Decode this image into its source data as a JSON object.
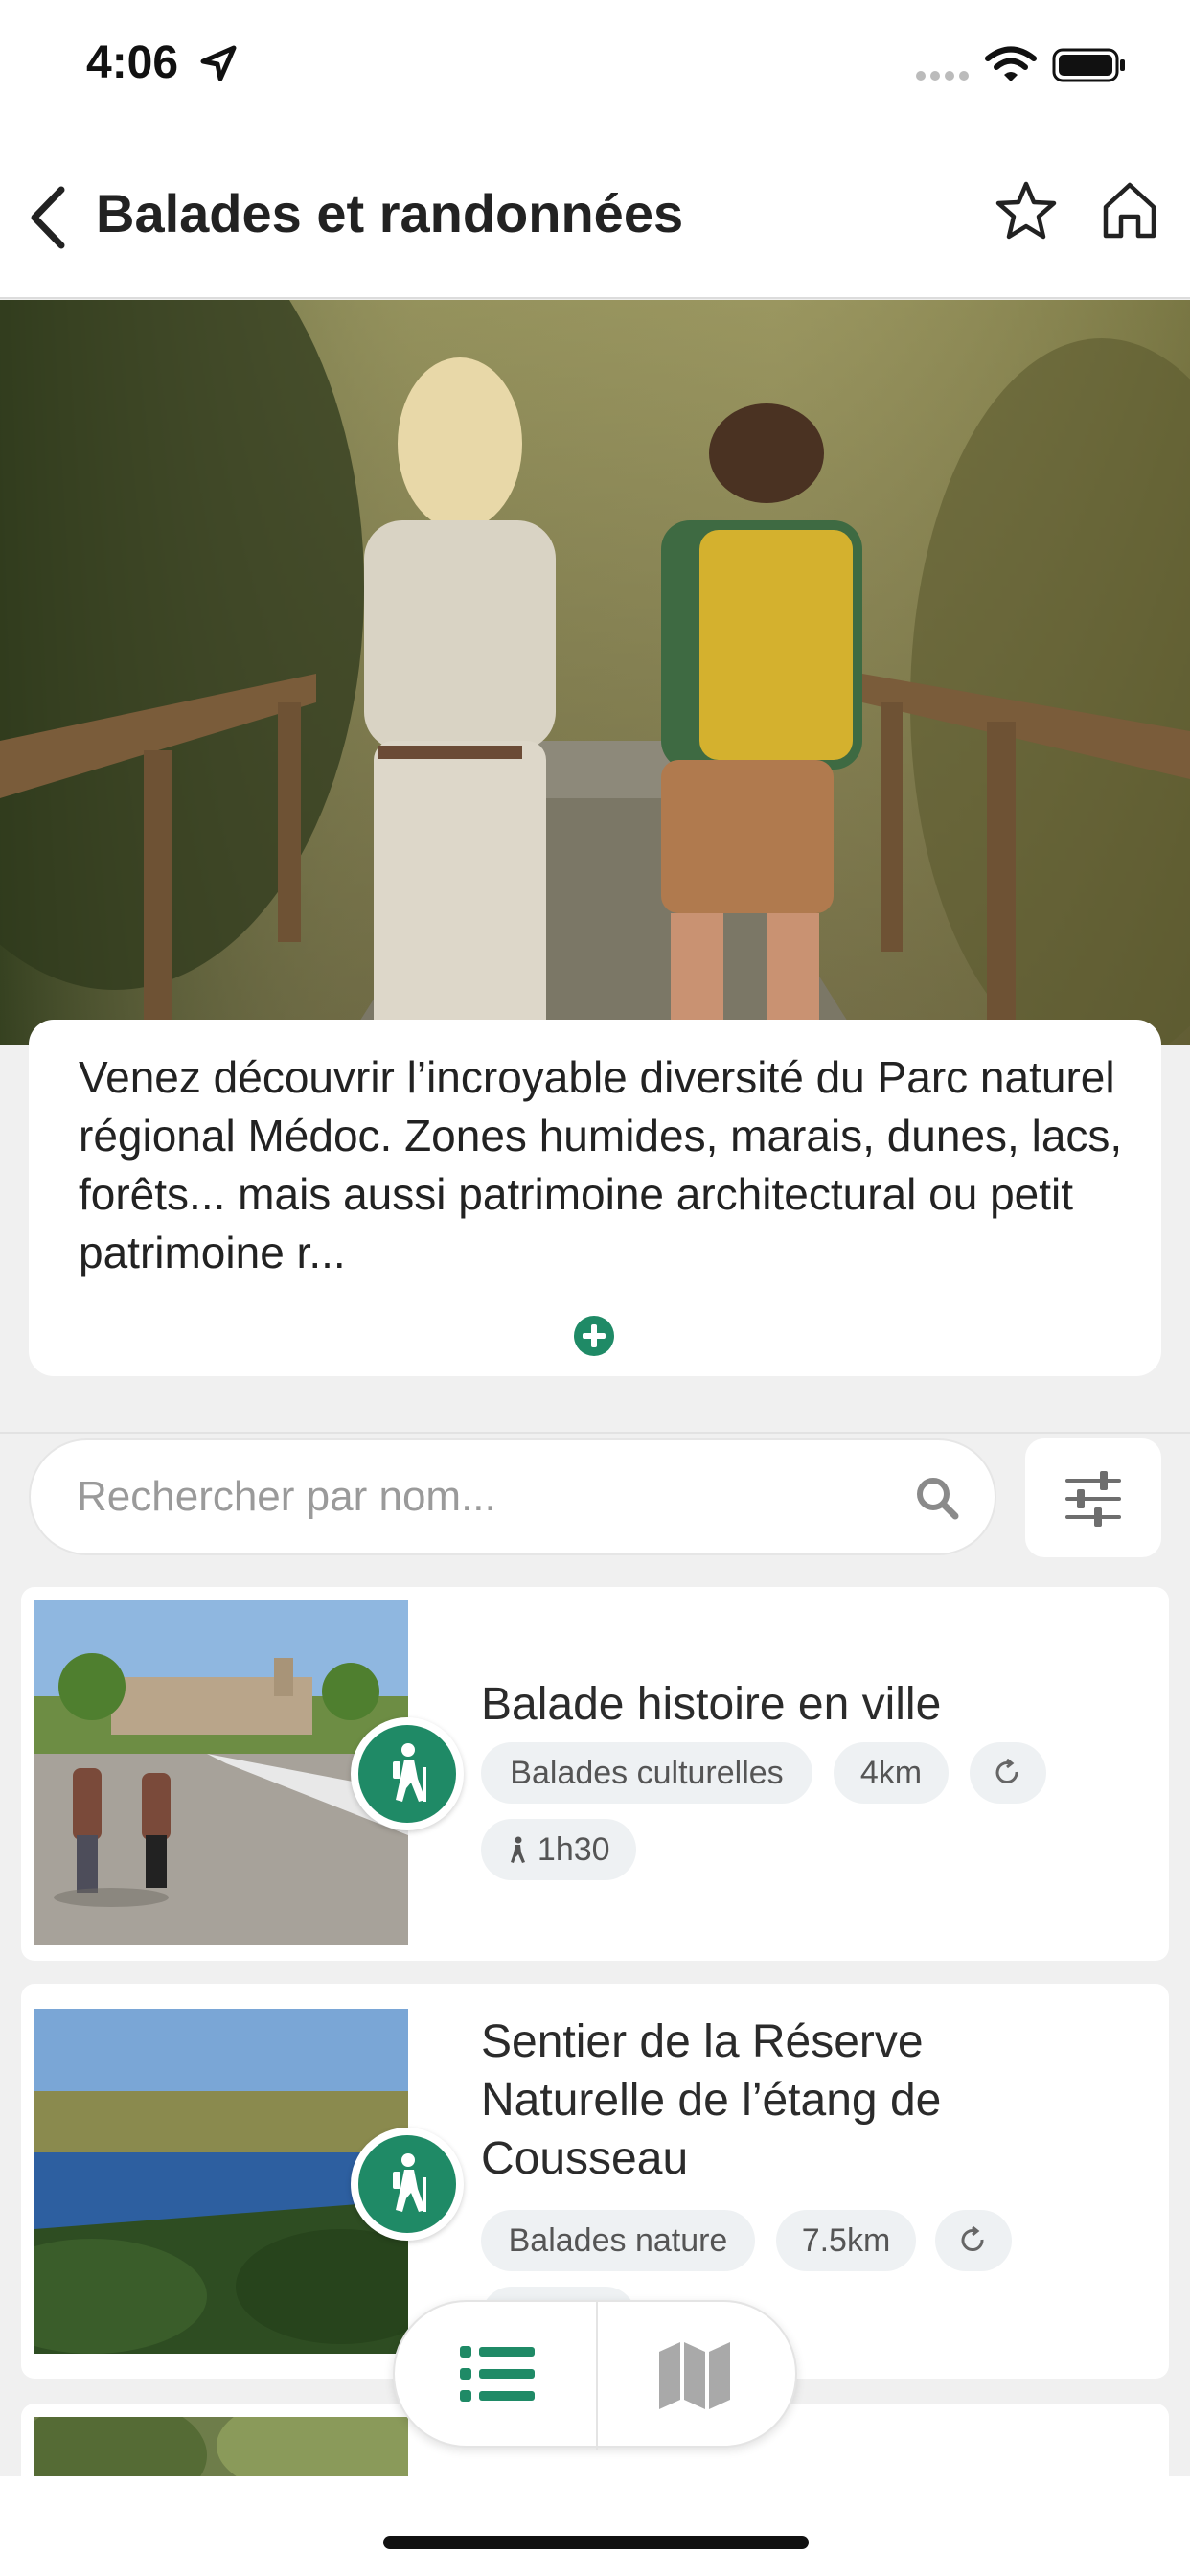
{
  "status_bar": {
    "time": "4:06"
  },
  "nav": {
    "title": "Balades et randonnées"
  },
  "description": {
    "text": "Venez découvrir l’incroyable diversité du Parc naturel régional Médoc. Zones humides, marais, dunes, lacs, forêts... mais aussi patrimoine architectural ou petit patrimoine r..."
  },
  "search": {
    "placeholder": "Rechercher par nom..."
  },
  "routes": [
    {
      "title": "Balade histoire en ville",
      "category": "Balades culturelles",
      "distance": "4km",
      "duration": "1h30"
    },
    {
      "title": "Sentier de la Réserve Naturelle de l’étang de Cousseau",
      "category": "Balades nature",
      "distance": "7.5km"
    }
  ],
  "colors": {
    "accent": "#1f8a66",
    "tag_bg": "#eef1f3",
    "page_bg": "#f0f0f0"
  }
}
